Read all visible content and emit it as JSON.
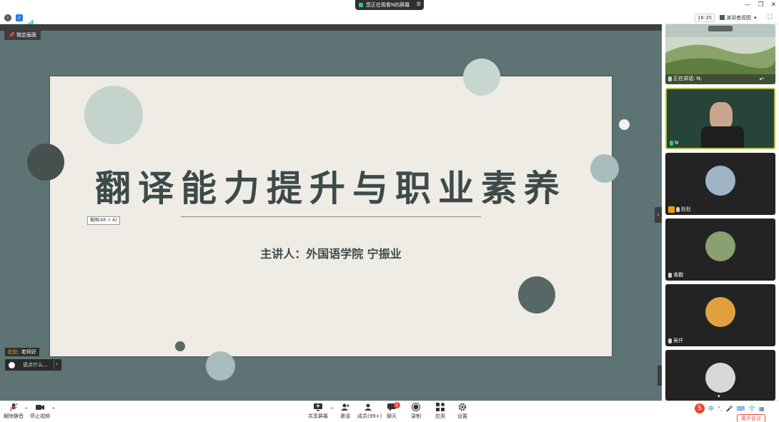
{
  "banner": {
    "text": "您正在观看N的屏幕"
  },
  "toolbar": {
    "clock": "16:35",
    "view_label": "演讲者视图"
  },
  "share": {
    "lock_label": "锁定画面",
    "slide_title": "翻译能力提升与职业素养",
    "slide_subtitle": "主讲人：外国语学院 宁振业",
    "tooltip": "截图(Alt + A)"
  },
  "chat": {
    "message_sender": "肚肚:",
    "message_text": " 老师好",
    "input_placeholder": "说点什么..."
  },
  "sidebar": {
    "speaking_label": "正在讲话: N;",
    "tiles": [
      {
        "name": "N"
      },
      {
        "name": "肚肚"
      },
      {
        "name": "谁戳"
      },
      {
        "name": "吴仟"
      }
    ]
  },
  "bottombar": {
    "unmute": "解除静音",
    "stop_video": "停止视频",
    "share_screen": "共享屏幕",
    "invite": "邀请",
    "members": "成员(99+)",
    "chat": "聊天",
    "chat_badge": "1",
    "record": "录制",
    "apps": "应用",
    "settings": "设置",
    "leave": "离开会议",
    "ime_lang": "中"
  },
  "colors": {
    "share_bg": "#5e7474",
    "slide_bg": "#efece5",
    "title_color": "#3e4a4a",
    "accent_red": "#e74c3c"
  }
}
